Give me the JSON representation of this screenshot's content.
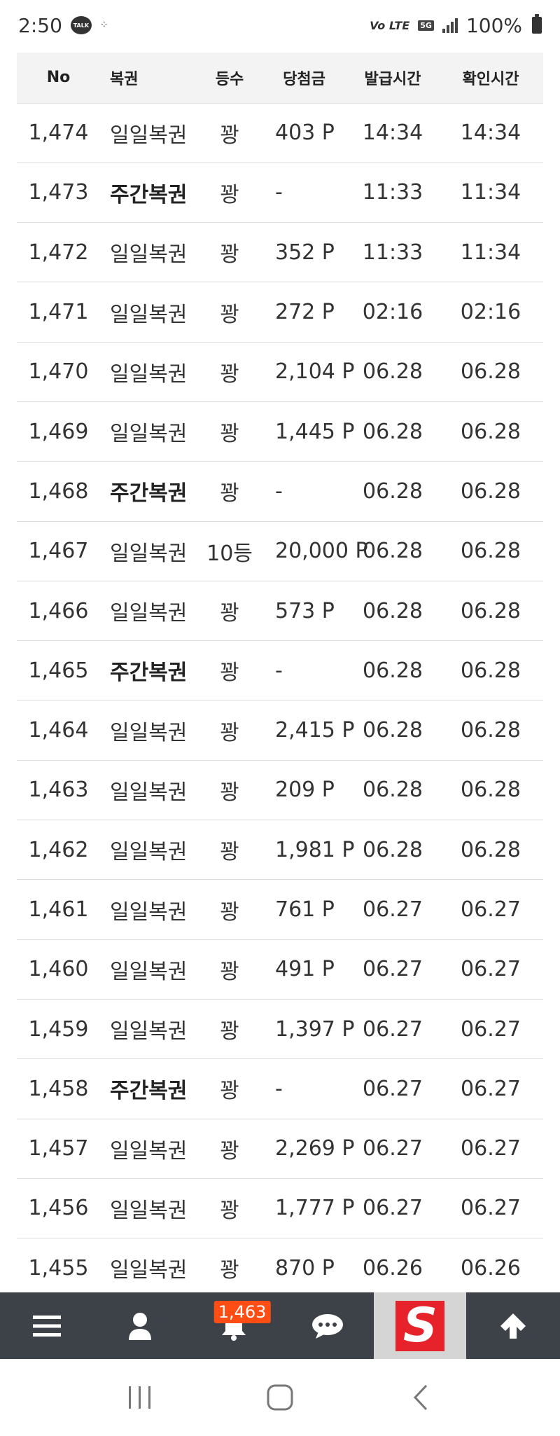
{
  "status": {
    "time": "2:50",
    "talk_label": "TALK",
    "lte_label": "Vo LTE",
    "fiveg_label": "5G",
    "battery": "100%"
  },
  "table": {
    "headers": {
      "no": "No",
      "type": "복권",
      "rank": "등수",
      "prize": "당첨금",
      "issued": "발급시간",
      "checked": "확인시간"
    },
    "rows": [
      {
        "no": "1,474",
        "type": "일일복권",
        "rank": "꽝",
        "prize": "403 P",
        "issued": "14:34",
        "checked": "14:34",
        "weekly": false
      },
      {
        "no": "1,473",
        "type": "주간복권",
        "rank": "꽝",
        "prize": "-",
        "issued": "11:33",
        "checked": "11:34",
        "weekly": true
      },
      {
        "no": "1,472",
        "type": "일일복권",
        "rank": "꽝",
        "prize": "352 P",
        "issued": "11:33",
        "checked": "11:34",
        "weekly": false
      },
      {
        "no": "1,471",
        "type": "일일복권",
        "rank": "꽝",
        "prize": "272 P",
        "issued": "02:16",
        "checked": "02:16",
        "weekly": false
      },
      {
        "no": "1,470",
        "type": "일일복권",
        "rank": "꽝",
        "prize": "2,104 P",
        "issued": "06.28",
        "checked": "06.28",
        "weekly": false
      },
      {
        "no": "1,469",
        "type": "일일복권",
        "rank": "꽝",
        "prize": "1,445 P",
        "issued": "06.28",
        "checked": "06.28",
        "weekly": false
      },
      {
        "no": "1,468",
        "type": "주간복권",
        "rank": "꽝",
        "prize": "-",
        "issued": "06.28",
        "checked": "06.28",
        "weekly": true
      },
      {
        "no": "1,467",
        "type": "일일복권",
        "rank": "10등",
        "prize": "20,000 P",
        "issued": "06.28",
        "checked": "06.28",
        "weekly": false
      },
      {
        "no": "1,466",
        "type": "일일복권",
        "rank": "꽝",
        "prize": "573 P",
        "issued": "06.28",
        "checked": "06.28",
        "weekly": false
      },
      {
        "no": "1,465",
        "type": "주간복권",
        "rank": "꽝",
        "prize": "-",
        "issued": "06.28",
        "checked": "06.28",
        "weekly": true
      },
      {
        "no": "1,464",
        "type": "일일복권",
        "rank": "꽝",
        "prize": "2,415 P",
        "issued": "06.28",
        "checked": "06.28",
        "weekly": false
      },
      {
        "no": "1,463",
        "type": "일일복권",
        "rank": "꽝",
        "prize": "209 P",
        "issued": "06.28",
        "checked": "06.28",
        "weekly": false
      },
      {
        "no": "1,462",
        "type": "일일복권",
        "rank": "꽝",
        "prize": "1,981 P",
        "issued": "06.28",
        "checked": "06.28",
        "weekly": false
      },
      {
        "no": "1,461",
        "type": "일일복권",
        "rank": "꽝",
        "prize": "761 P",
        "issued": "06.27",
        "checked": "06.27",
        "weekly": false
      },
      {
        "no": "1,460",
        "type": "일일복권",
        "rank": "꽝",
        "prize": "491 P",
        "issued": "06.27",
        "checked": "06.27",
        "weekly": false
      },
      {
        "no": "1,459",
        "type": "일일복권",
        "rank": "꽝",
        "prize": "1,397 P",
        "issued": "06.27",
        "checked": "06.27",
        "weekly": false
      },
      {
        "no": "1,458",
        "type": "주간복권",
        "rank": "꽝",
        "prize": "-",
        "issued": "06.27",
        "checked": "06.27",
        "weekly": true
      },
      {
        "no": "1,457",
        "type": "일일복권",
        "rank": "꽝",
        "prize": "2,269 P",
        "issued": "06.27",
        "checked": "06.27",
        "weekly": false
      },
      {
        "no": "1,456",
        "type": "일일복권",
        "rank": "꽝",
        "prize": "1,777 P",
        "issued": "06.27",
        "checked": "06.27",
        "weekly": false
      },
      {
        "no": "1,455",
        "type": "일일복권",
        "rank": "꽝",
        "prize": "870 P",
        "issued": "06.26",
        "checked": "06.26",
        "weekly": false
      }
    ]
  },
  "bottom_nav": {
    "notification_count": "1,463",
    "logo_letter": "S",
    "icons": [
      "menu-icon",
      "user-icon",
      "bell-icon",
      "chat-icon",
      "logo",
      "arrow-up-icon"
    ]
  },
  "colors": {
    "nav_bg": "#3d4148",
    "badge": "#ff4d14",
    "logo_red": "#e6222a",
    "header_bg": "#f3f3f3"
  }
}
